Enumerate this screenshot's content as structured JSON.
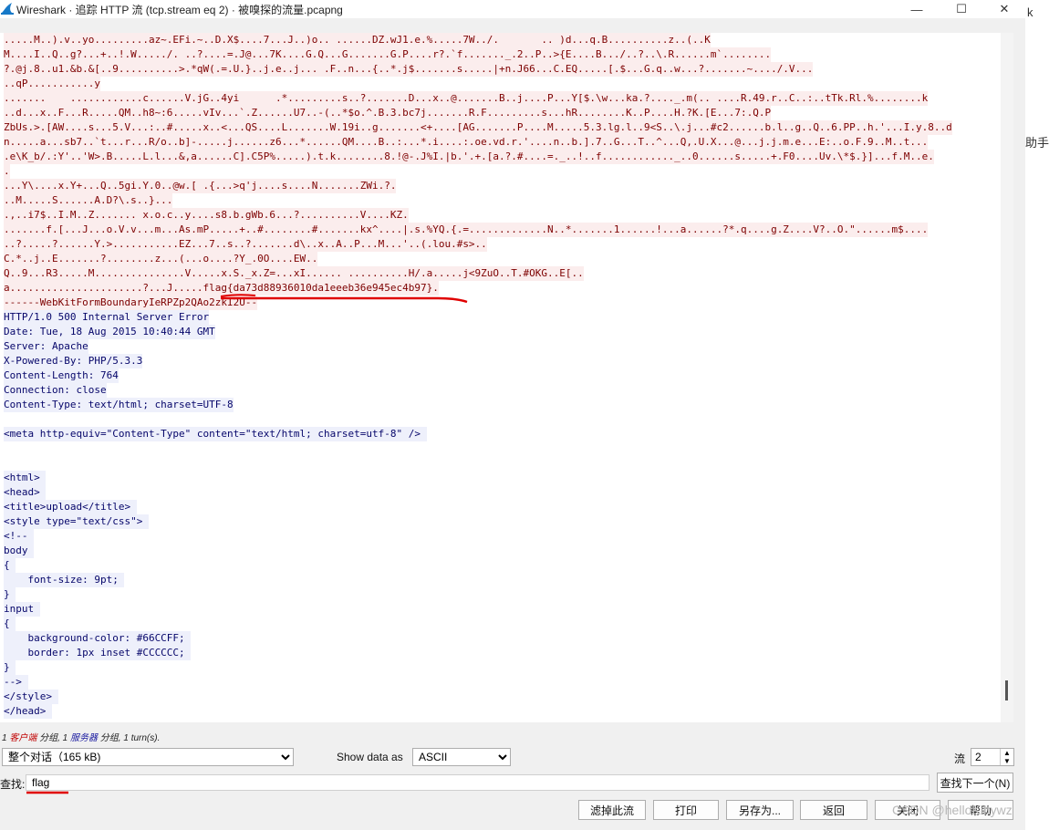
{
  "window": {
    "title": "Wireshark · 追踪 HTTP 流 (tcp.stream eq 2) · 被嗅探的流量.pcapng",
    "minimize": "—",
    "maximize": "☐",
    "close": "✕"
  },
  "stream_lines": [
    {
      "dir": "c",
      "text": ".....M..).v..yo.........az~.EFi.~..D.X$....7...J..)o.. ......DZ.wJ1.e.%.....7W../.       .. )d...q.B..........z..(..K"
    },
    {
      "dir": "c",
      "text": "M....I..Q..g?...+..!.W...../. ..?....=.J@...7K....G.Q...G.......G.P....r?.`f......._.2..P..>{E....B.../..?..\\.R......m`........"
    },
    {
      "dir": "c",
      "text": "?.@j.8..u1.&b.&[..9..........>.*qW(.=.U.}..j.e..j... .F..n...{..*.j$.......s.....|+n.J66...C.EQ.....[.$...G.q..w...?.......~..../.V..."
    },
    {
      "dir": "c",
      "text": "..qP...........y"
    },
    {
      "dir": "c",
      "text": ".......    ............c......V.jG..4yi      .*.........s..?.......D...x..@.......B..j....P...Y[$.\\w...ka.?...._.m(.. ....R.49.r..C..:..tTk.Rl.%........k"
    },
    {
      "dir": "c",
      "text": "..d...x..F...R.....QM..h8~:6.....vIv...`.Z......U7..-(..*$o.^.B.3.bc7j.......R.F.........s...hR........K..P....H.?K.[E...7:.Q.P"
    },
    {
      "dir": "c",
      "text": "ZbUs.>.[AW....s...5.V...:..#.....x..<...QS....L.......W.19i..g.......<+....[AG.......P....M.....5.3.lg.l..9<S..\\.j...#c2......b.l..g..Q..6.PP..h.'...I.y.8..d"
    },
    {
      "dir": "c",
      "text": "n.....a...sb7..`t...r...R/o..b]-.....j......z6...*......QM....B..:...*.i....:.oe.vd.r.'....n..b.].7..G...T..^...Q,.U.X...@...j.j.m.e...E:..o.F.9..M..t..."
    },
    {
      "dir": "c",
      "text": ".e\\K_b/.:Y'..'W>.B.....L.l...&,a......C].C5P%.....).t.k........8.!@-.J%I.|b.'.+.[a.?.#....=._..!..f............_..0......s.....+.F0....Uv.\\*$.}]...f.M..e."
    },
    {
      "dir": "c",
      "text": "."
    },
    {
      "dir": "c",
      "text": "...Y\\....x.Y+...Q..5gi.Y.0..@w.[ .{...>q'j....s....N.......ZWi.?."
    },
    {
      "dir": "c",
      "text": "..M.....S......A.D?\\.s..}..."
    },
    {
      "dir": "c",
      "text": ".,..i7$..I.M..Z....... x.o.c..y....s8.b.gWb.6...?..........V....KZ."
    },
    {
      "dir": "c",
      "text": ".......f.[...J...o.V.v...m...As.mP.....+..#........#.......kx^....|.s.%YQ.{.=.............N..*.......1......!...a......?*.q....g.Z....V?..O.\"......m$...."
    },
    {
      "dir": "c",
      "text": "..?.....?......Y.>...........EZ...7..s..?.......d\\..x..A..P...M...'..(.lou.#s>.."
    },
    {
      "dir": "c",
      "text": "C.*..j..E.......?........z...(...o....?Y_.0O....EW.."
    },
    {
      "dir": "c",
      "text": "Q..9...R3.....M...............V.....x.S._x.Z=...xI...... ..........H/.a.....j<9ZuO..T.#OKG..E[.."
    },
    {
      "dir": "c",
      "text": "a......................?...J.....flag{da73d88936010da1eeeb36e945ec4b97}."
    },
    {
      "dir": "c",
      "text": "------WebKitFormBoundaryIeRPZp2QAo2zkI2U--"
    },
    {
      "dir": "s",
      "text": "HTTP/1.0 500 Internal Server Error"
    },
    {
      "dir": "s",
      "text": "Date: Tue, 18 Aug 2015 10:40:44 GMT"
    },
    {
      "dir": "s",
      "text": "Server: Apache"
    },
    {
      "dir": "s",
      "text": "X-Powered-By: PHP/5.3.3"
    },
    {
      "dir": "s",
      "text": "Content-Length: 764"
    },
    {
      "dir": "s",
      "text": "Connection: close"
    },
    {
      "dir": "s",
      "text": "Content-Type: text/html; charset=UTF-8"
    },
    {
      "dir": "s",
      "text": ""
    },
    {
      "dir": "s",
      "text": "<meta http-equiv=\"Content-Type\" content=\"text/html; charset=utf-8\" /> "
    },
    {
      "dir": "s",
      "text": ""
    },
    {
      "dir": "s",
      "text": ""
    },
    {
      "dir": "s",
      "text": "<html> "
    },
    {
      "dir": "s",
      "text": "<head> "
    },
    {
      "dir": "s",
      "text": "<title>upload</title> "
    },
    {
      "dir": "s",
      "text": "<style type=\"text/css\"> "
    },
    {
      "dir": "s",
      "text": "<!-- "
    },
    {
      "dir": "s",
      "text": "body "
    },
    {
      "dir": "s",
      "text": "{ "
    },
    {
      "dir": "s",
      "text": "    font-size: 9pt; "
    },
    {
      "dir": "s",
      "text": "} "
    },
    {
      "dir": "s",
      "text": "input "
    },
    {
      "dir": "s",
      "text": "{ "
    },
    {
      "dir": "s",
      "text": "    background-color: #66CCFF; "
    },
    {
      "dir": "s",
      "text": "    border: 1px inset #CCCCCC; "
    },
    {
      "dir": "s",
      "text": "} "
    },
    {
      "dir": "s",
      "text": "--> "
    },
    {
      "dir": "s",
      "text": "</style> "
    },
    {
      "dir": "s",
      "text": "</head> "
    }
  ],
  "status": {
    "part1": "1 ",
    "client": "客户端",
    "part2": " 分组, 1 ",
    "server": "服务器",
    "part3": " 分组, 1 turn(s)."
  },
  "controls": {
    "conversation_select": "整个对话（165 kB)",
    "show_data_label": "Show data as",
    "show_data_value": "ASCII",
    "stream_label": "流",
    "stream_value": "2",
    "find_label": "查找:",
    "find_value": "flag",
    "find_next": "查找下一个(N)"
  },
  "buttons": {
    "filter_out": "滤掉此流",
    "print": "打印",
    "save_as": "另存为...",
    "back": "返回",
    "close": "关闭",
    "help": "帮助"
  },
  "side": {
    "helper_text": "助手",
    "top_glyph": "k"
  },
  "watermark": "CSDN @helloKittywz",
  "colors": {
    "client_bg": "#fbeded",
    "client_fg": "#7d0000",
    "server_bg": "#eef0fb",
    "server_fg": "#06066a",
    "annotation": "#e00000"
  }
}
